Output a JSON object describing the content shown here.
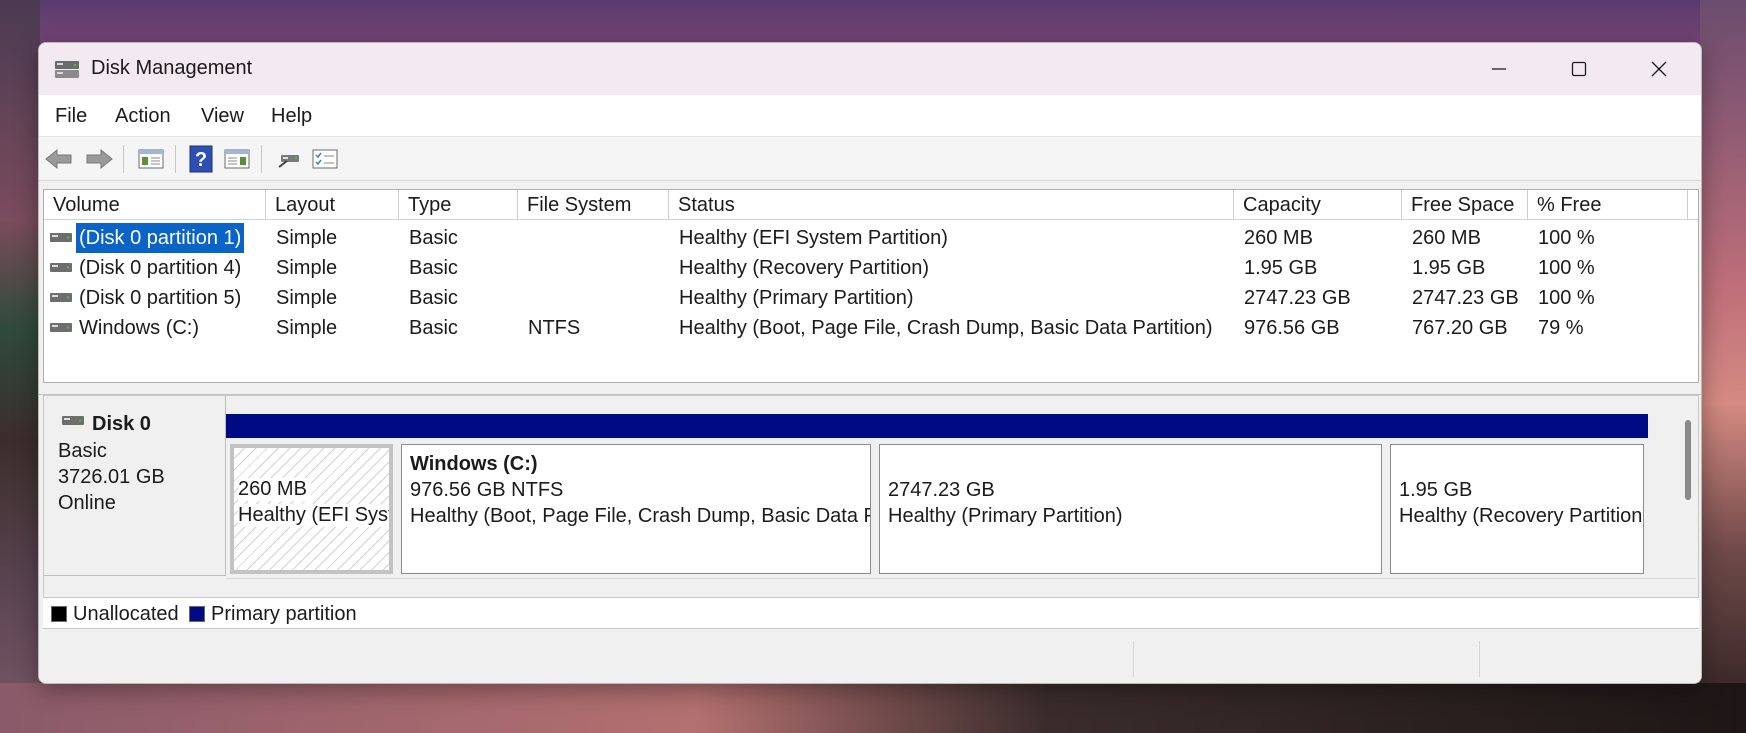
{
  "window": {
    "title": "Disk Management"
  },
  "caption": {
    "minimize": "—",
    "maximize": "☐",
    "close": "✕"
  },
  "menu": [
    "File",
    "Action",
    "View",
    "Help"
  ],
  "toolbar": {
    "icons": [
      "back-arrow-icon",
      "forward-arrow-icon",
      "console-tree-icon",
      "help-icon",
      "action-pane-icon",
      "connect-icon",
      "properties-icon"
    ]
  },
  "volumes": {
    "columns": [
      "Volume",
      "Layout",
      "Type",
      "File System",
      "Status",
      "Capacity",
      "Free Space",
      "% Free"
    ],
    "rows": [
      {
        "volume": "(Disk 0 partition 1)",
        "layout": "Simple",
        "type": "Basic",
        "fs": "",
        "status": "Healthy (EFI System Partition)",
        "capacity": "260 MB",
        "free": "260 MB",
        "pct": "100 %",
        "selected": true
      },
      {
        "volume": "(Disk 0 partition 4)",
        "layout": "Simple",
        "type": "Basic",
        "fs": "",
        "status": "Healthy (Recovery Partition)",
        "capacity": "1.95 GB",
        "free": "1.95 GB",
        "pct": "100 %",
        "selected": false
      },
      {
        "volume": "(Disk 0 partition 5)",
        "layout": "Simple",
        "type": "Basic",
        "fs": "",
        "status": "Healthy (Primary Partition)",
        "capacity": "2747.23 GB",
        "free": "2747.23 GB",
        "pct": "100 %",
        "selected": false
      },
      {
        "volume": "Windows (C:)",
        "layout": "Simple",
        "type": "Basic",
        "fs": "NTFS",
        "status": "Healthy (Boot, Page File, Crash Dump, Basic Data Partition)",
        "capacity": "976.56 GB",
        "free": "767.20 GB",
        "pct": "79 %",
        "selected": false
      }
    ]
  },
  "disk": {
    "name": "Disk 0",
    "type": "Basic",
    "size": "3726.01 GB",
    "state": "Online",
    "partitions": [
      {
        "title": "",
        "line1": "260 MB",
        "line2": "Healthy (EFI System Partition)"
      },
      {
        "title": "Windows  (C:)",
        "line1": "976.56 GB NTFS",
        "line2": "Healthy (Boot, Page File, Crash Dump, Basic Data Partition)"
      },
      {
        "title": "",
        "line1": "2747.23 GB",
        "line2": "Healthy (Primary Partition)"
      },
      {
        "title": "",
        "line1": "1.95 GB",
        "line2": "Healthy (Recovery Partition)"
      }
    ]
  },
  "legend": [
    {
      "label": "Unallocated",
      "color": "#000000"
    },
    {
      "label": "Primary partition",
      "color": "#000a82"
    }
  ],
  "colors": {
    "accent_selection": "#0a64c8",
    "primary_partition": "#000a82"
  }
}
